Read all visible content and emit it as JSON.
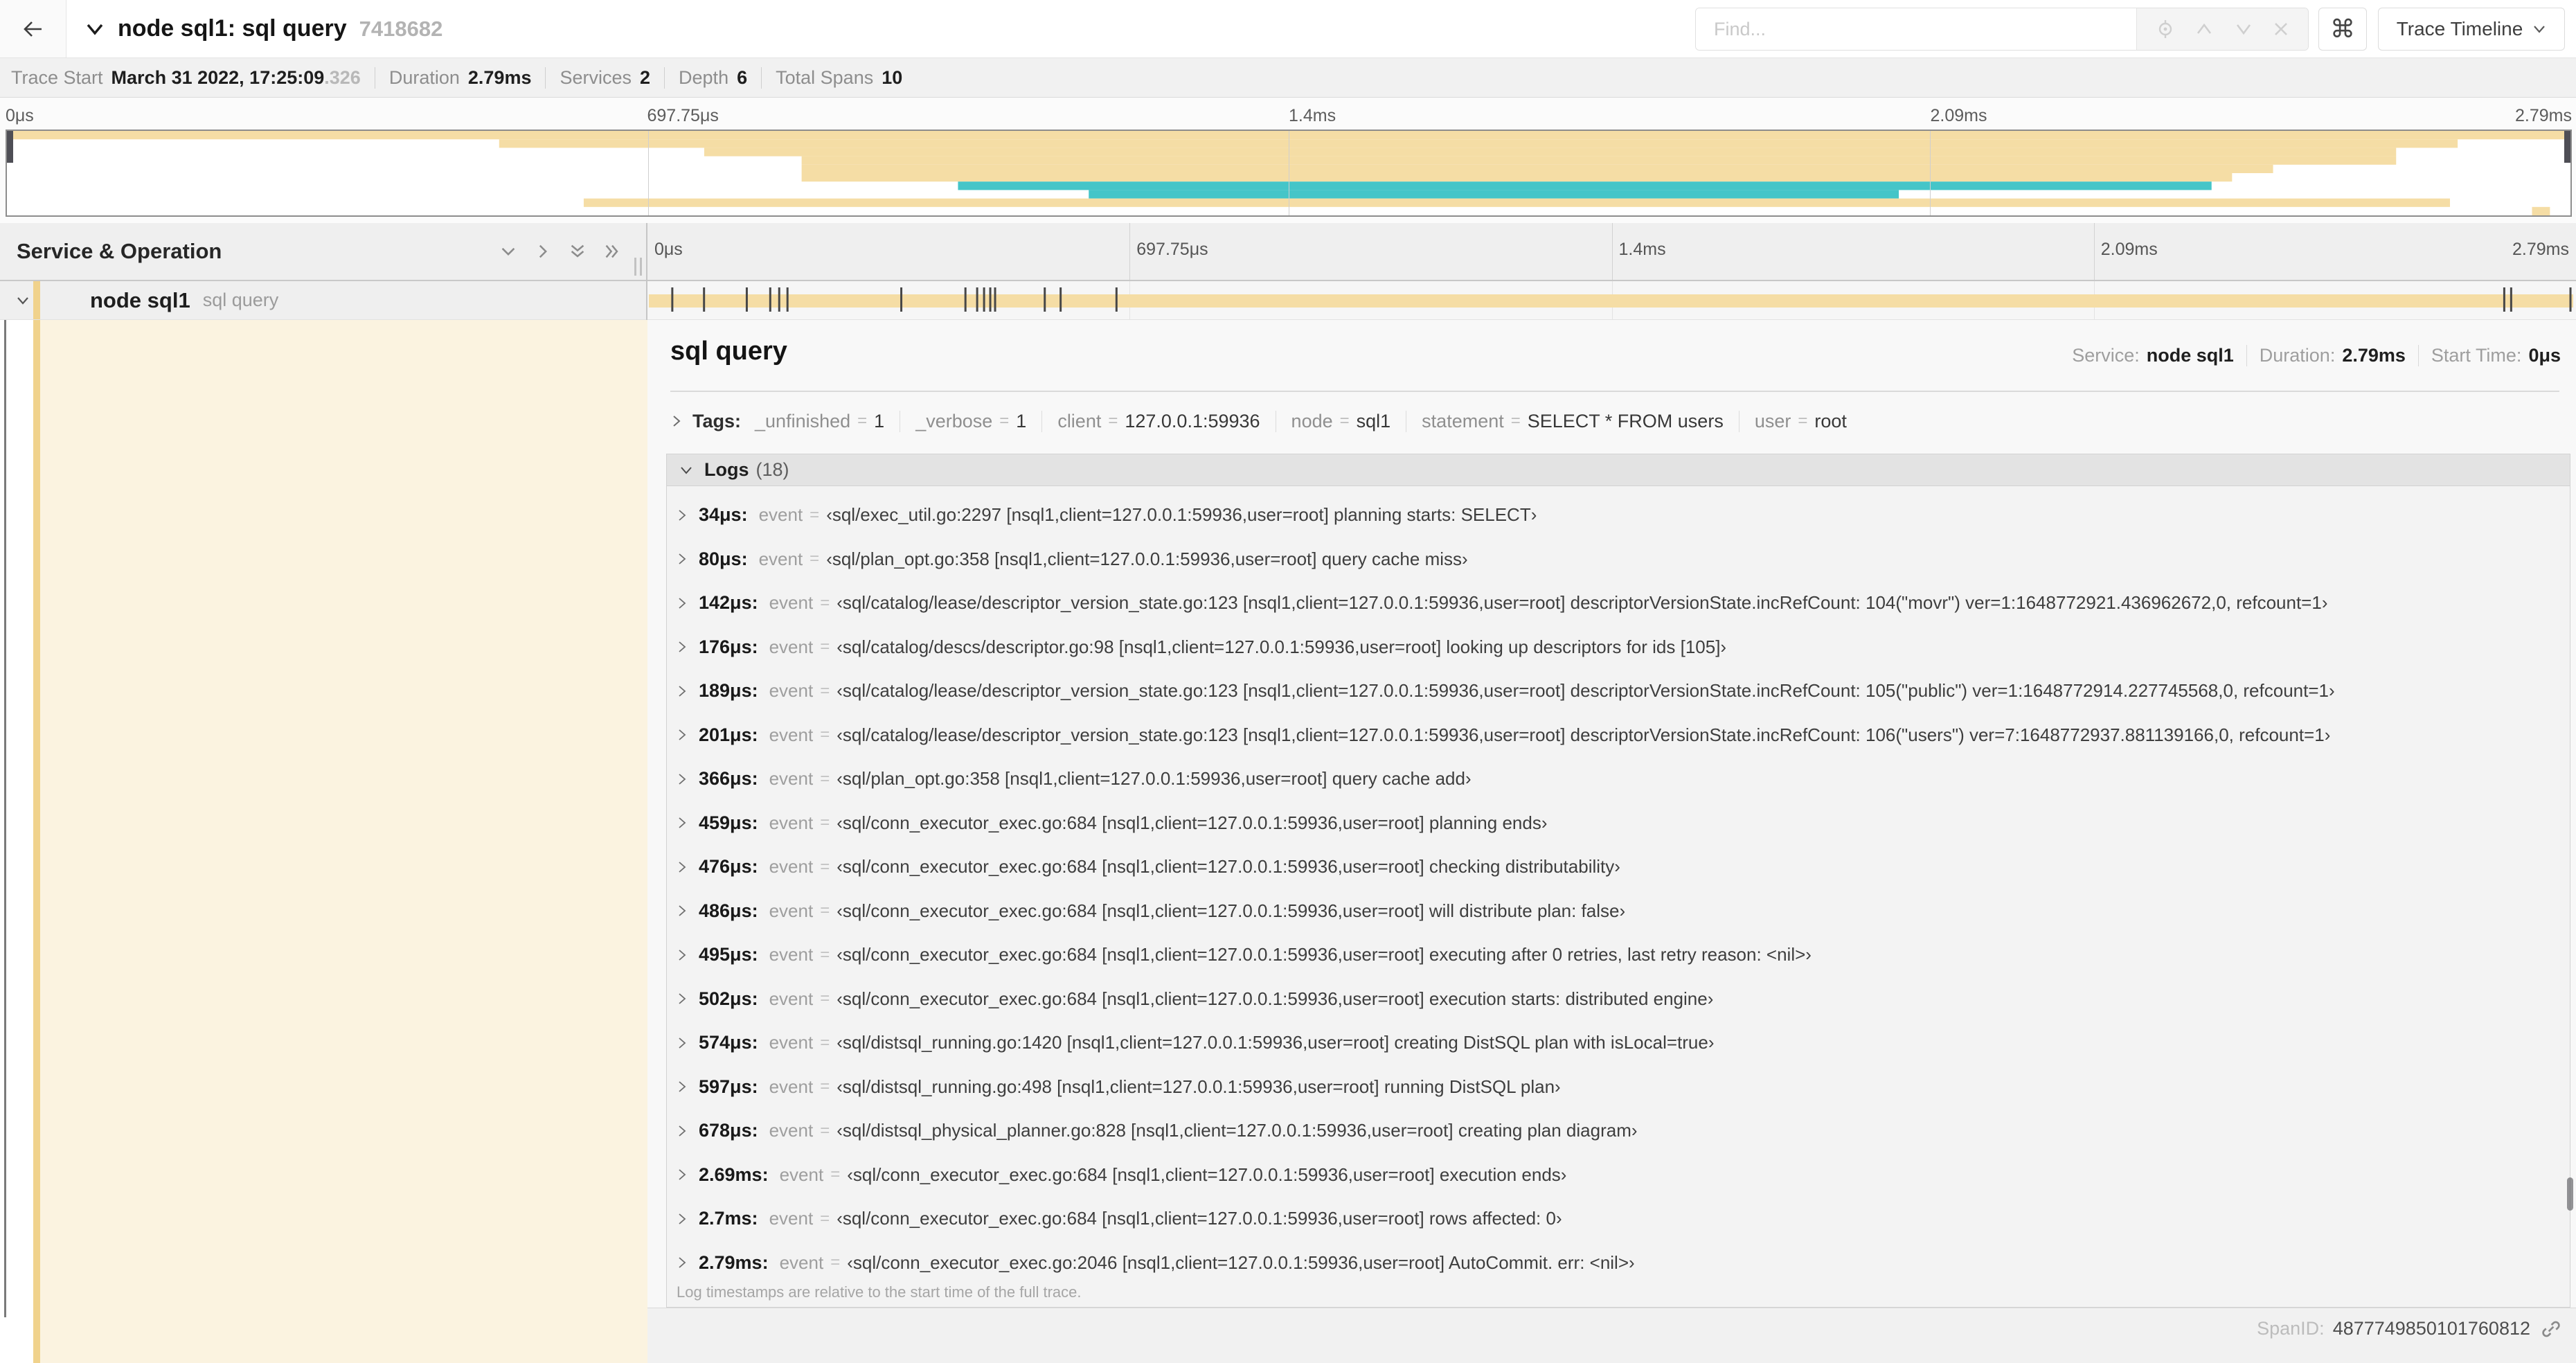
{
  "colors": {
    "tan": "#f5dda5",
    "teal": "#45c5c8",
    "accent": "#f0d28c",
    "cream": "#fbf3e0",
    "log_tick": "#474747"
  },
  "header": {
    "title": "node sql1: sql query",
    "trace_id": "7418682",
    "find_placeholder": "Find...",
    "keyboard_shortcut_glyph": "⌘",
    "view_label": "Trace Timeline"
  },
  "trace_info": {
    "items": [
      {
        "label": "Trace Start",
        "value": "March 31 2022, 17:25:09",
        "suffix": ".326"
      },
      {
        "label": "Duration",
        "value": "2.79ms",
        "suffix": ""
      },
      {
        "label": "Services",
        "value": "2",
        "suffix": ""
      },
      {
        "label": "Depth",
        "value": "6",
        "suffix": ""
      },
      {
        "label": "Total Spans",
        "value": "10",
        "suffix": ""
      }
    ]
  },
  "axis_ticks": [
    {
      "label": "0μs",
      "pos": 0
    },
    {
      "label": "697.75μs",
      "pos": 25
    },
    {
      "label": "1.4ms",
      "pos": 50
    },
    {
      "label": "2.09ms",
      "pos": 75
    },
    {
      "label": "2.79ms",
      "pos": 100
    }
  ],
  "minimap": {
    "bars": [
      {
        "row": 0,
        "s": 0.0,
        "e": 1.0,
        "color": "tan"
      },
      {
        "row": 1,
        "s": 0.192,
        "e": 0.956,
        "color": "tan"
      },
      {
        "row": 2,
        "s": 0.272,
        "e": 0.932,
        "color": "tan"
      },
      {
        "row": 3,
        "s": 0.31,
        "e": 0.932,
        "color": "tan"
      },
      {
        "row": 4,
        "s": 0.31,
        "e": 0.884,
        "color": "tan"
      },
      {
        "row": 5,
        "s": 0.31,
        "e": 0.868,
        "color": "tan"
      },
      {
        "row": 6,
        "s": 0.371,
        "e": 0.86,
        "color": "teal"
      },
      {
        "row": 7,
        "s": 0.422,
        "e": 0.738,
        "color": "teal"
      },
      {
        "row": 8,
        "s": 0.225,
        "e": 0.953,
        "color": "tan"
      },
      {
        "row": 9,
        "s": 0.985,
        "e": 0.992,
        "color": "tan"
      }
    ]
  },
  "timeline": {
    "panel_title": "Service & Operation",
    "service": "node sql1",
    "operation": "sql query",
    "total_us": 2790,
    "log_marks_us": [
      34,
      80,
      142,
      176,
      189,
      201,
      366,
      459,
      476,
      486,
      495,
      502,
      574,
      597,
      678,
      2690,
      2700,
      2786
    ]
  },
  "detail": {
    "title": "sql query",
    "meta": [
      {
        "label": "Service:",
        "value": "node sql1"
      },
      {
        "label": "Duration:",
        "value": "2.79ms"
      },
      {
        "label": "Start Time:",
        "value": "0μs"
      }
    ],
    "tags": {
      "label": "Tags:",
      "eq": "=",
      "items": [
        {
          "key": "_unfinished",
          "value": "1"
        },
        {
          "key": "_verbose",
          "value": "1"
        },
        {
          "key": "client",
          "value": "127.0.0.1:59936"
        },
        {
          "key": "node",
          "value": "sql1"
        },
        {
          "key": "statement",
          "value": "SELECT * FROM users"
        },
        {
          "key": "user",
          "value": "root"
        }
      ]
    },
    "logs": {
      "label": "Logs",
      "count": "(18)",
      "key_label": "event",
      "eq": "=",
      "entries": [
        {
          "time": "34μs:",
          "value": "‹sql/exec_util.go:2297 [nsql1,client=127.0.0.1:59936,user=root] planning starts: SELECT›"
        },
        {
          "time": "80μs:",
          "value": "‹sql/plan_opt.go:358 [nsql1,client=127.0.0.1:59936,user=root] query cache miss›"
        },
        {
          "time": "142μs:",
          "value": "‹sql/catalog/lease/descriptor_version_state.go:123 [nsql1,client=127.0.0.1:59936,user=root] descriptorVersionState.incRefCount: 104(\"movr\") ver=1:1648772921.436962672,0, refcount=1›"
        },
        {
          "time": "176μs:",
          "value": "‹sql/catalog/descs/descriptor.go:98 [nsql1,client=127.0.0.1:59936,user=root] looking up descriptors for ids [105]›"
        },
        {
          "time": "189μs:",
          "value": "‹sql/catalog/lease/descriptor_version_state.go:123 [nsql1,client=127.0.0.1:59936,user=root] descriptorVersionState.incRefCount: 105(\"public\") ver=1:1648772914.227745568,0, refcount=1›"
        },
        {
          "time": "201μs:",
          "value": "‹sql/catalog/lease/descriptor_version_state.go:123 [nsql1,client=127.0.0.1:59936,user=root] descriptorVersionState.incRefCount: 106(\"users\") ver=7:1648772937.881139166,0, refcount=1›"
        },
        {
          "time": "366μs:",
          "value": "‹sql/plan_opt.go:358 [nsql1,client=127.0.0.1:59936,user=root] query cache add›"
        },
        {
          "time": "459μs:",
          "value": "‹sql/conn_executor_exec.go:684 [nsql1,client=127.0.0.1:59936,user=root] planning ends›"
        },
        {
          "time": "476μs:",
          "value": "‹sql/conn_executor_exec.go:684 [nsql1,client=127.0.0.1:59936,user=root] checking distributability›"
        },
        {
          "time": "486μs:",
          "value": "‹sql/conn_executor_exec.go:684 [nsql1,client=127.0.0.1:59936,user=root] will distribute plan: false›"
        },
        {
          "time": "495μs:",
          "value": "‹sql/conn_executor_exec.go:684 [nsql1,client=127.0.0.1:59936,user=root] executing after 0 retries, last retry reason: <nil>›"
        },
        {
          "time": "502μs:",
          "value": "‹sql/conn_executor_exec.go:684 [nsql1,client=127.0.0.1:59936,user=root] execution starts: distributed engine›"
        },
        {
          "time": "574μs:",
          "value": "‹sql/distsql_running.go:1420 [nsql1,client=127.0.0.1:59936,user=root] creating DistSQL plan with isLocal=true›"
        },
        {
          "time": "597μs:",
          "value": "‹sql/distsql_running.go:498 [nsql1,client=127.0.0.1:59936,user=root] running DistSQL plan›"
        },
        {
          "time": "678μs:",
          "value": "‹sql/distsql_physical_planner.go:828 [nsql1,client=127.0.0.1:59936,user=root] creating plan diagram›"
        },
        {
          "time": "2.69ms:",
          "value": "‹sql/conn_executor_exec.go:684 [nsql1,client=127.0.0.1:59936,user=root] execution ends›"
        },
        {
          "time": "2.7ms:",
          "value": "‹sql/conn_executor_exec.go:684 [nsql1,client=127.0.0.1:59936,user=root] rows affected: 0›"
        },
        {
          "time": "2.79ms:",
          "value": "‹sql/conn_executor_exec.go:2046 [nsql1,client=127.0.0.1:59936,user=root] AutoCommit. err: <nil>›"
        }
      ],
      "note": "Log timestamps are relative to the start time of the full trace."
    },
    "footer": {
      "label": "SpanID:",
      "value": "4877749850101760812"
    }
  }
}
